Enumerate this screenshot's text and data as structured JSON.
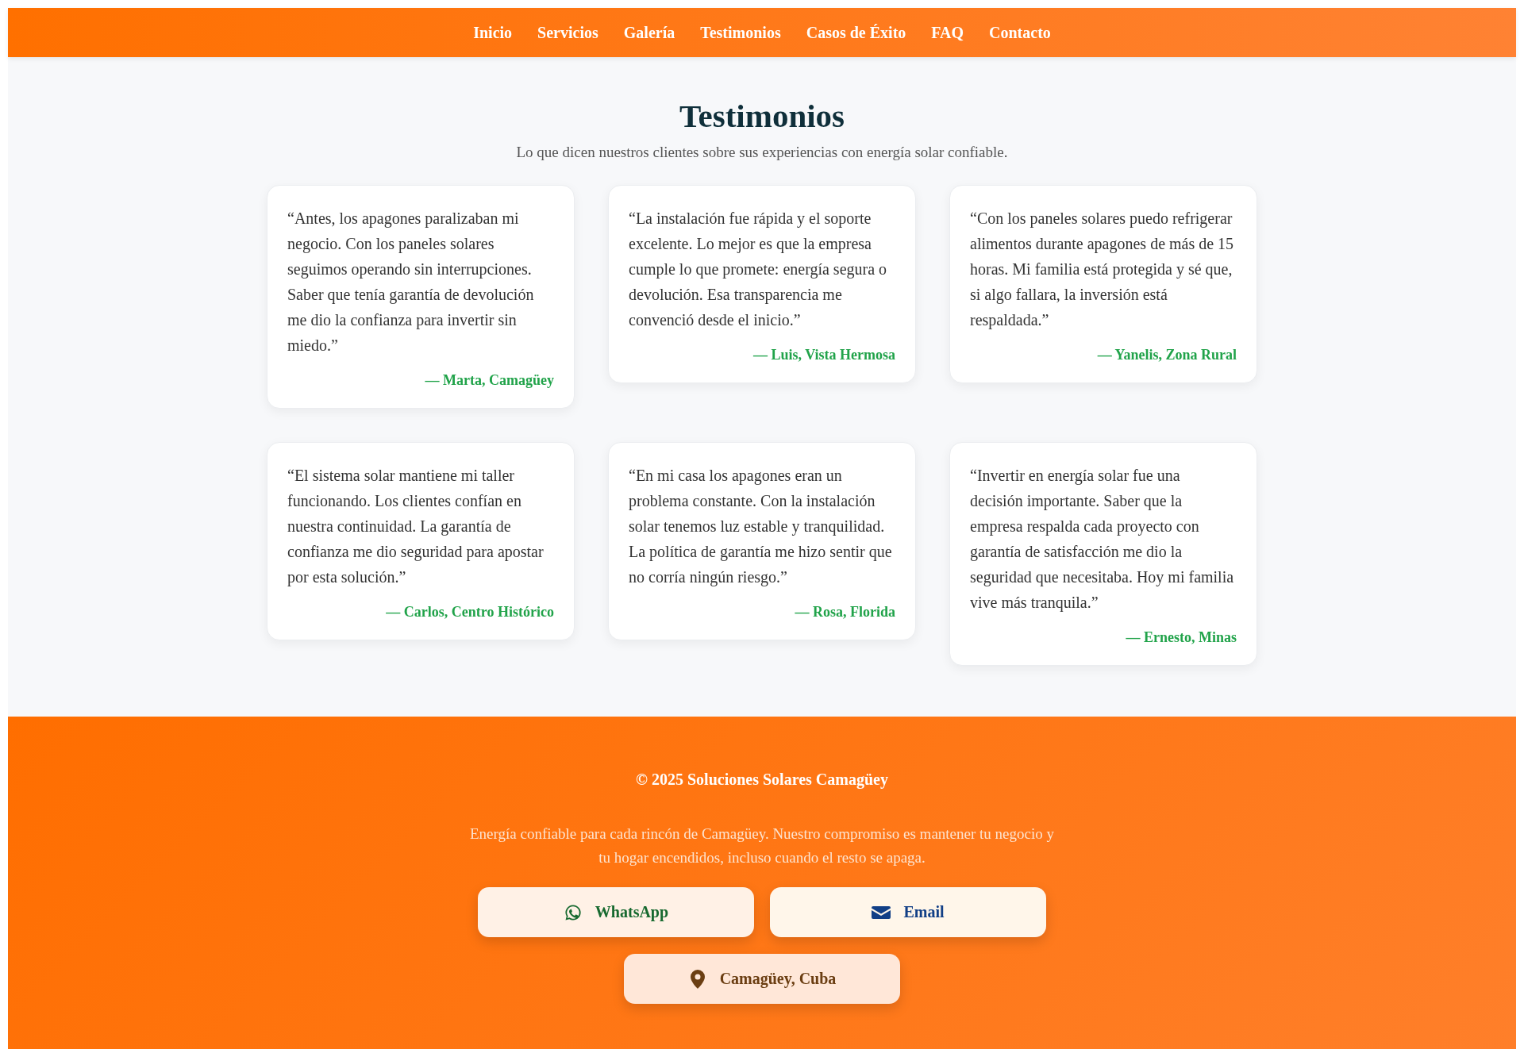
{
  "nav": [
    {
      "label": "Inicio"
    },
    {
      "label": "Servicios"
    },
    {
      "label": "Galería"
    },
    {
      "label": "Testimonios"
    },
    {
      "label": "Casos de Éxito"
    },
    {
      "label": "FAQ"
    },
    {
      "label": "Contacto"
    }
  ],
  "section": {
    "title": "Testimonios",
    "subtitle": "Lo que dicen nuestros clientes sobre sus experiencias con energía solar confiable."
  },
  "testimonials": [
    {
      "quote": "“Antes, los apagones paralizaban mi negocio. Con los paneles solares seguimos operando sin interrupciones. Saber que tenía garantía de devolución me dio la confianza para invertir sin miedo.”",
      "author": "— Marta, Camagüey"
    },
    {
      "quote": "“La instalación fue rápida y el soporte excelente. Lo mejor es que la empresa cumple lo que promete: energía segura o devolución. Esa transparencia me convenció desde el inicio.”",
      "author": "— Luis, Vista Hermosa"
    },
    {
      "quote": "“Con los paneles solares puedo refrigerar alimentos durante apagones de más de 15 horas. Mi familia está protegida y sé que, si algo fallara, la inversión está respaldada.”",
      "author": "— Yanelis, Zona Rural"
    },
    {
      "quote": "“El sistema solar mantiene mi taller funcionando. Los clientes confían en nuestra continuidad. La garantía de confianza me dio seguridad para apostar por esta solución.”",
      "author": "— Carlos, Centro Histórico"
    },
    {
      "quote": "“En mi casa los apagones eran un problema constante. Con la instalación solar tenemos luz estable y tranquilidad. La política de garantía me hizo sentir que no corría ningún riesgo.”",
      "author": "— Rosa, Florida"
    },
    {
      "quote": "“Invertir en energía solar fue una decisión importante. Saber que la empresa respalda cada proyecto con garantía de satisfacción me dio la seguridad que necesitaba. Hoy mi familia vive más tranquila.”",
      "author": "— Ernesto, Minas"
    }
  ],
  "footer": {
    "copyright": "© 2025 Soluciones Solares Camagüey",
    "text": "Energía confiable para cada rincón de Camagüey. Nuestro compromiso es mantener tu negocio y tu hogar encendidos, incluso cuando el resto se apaga.",
    "buttons": [
      {
        "kind": "whatsapp",
        "label": "WhatsApp"
      },
      {
        "kind": "email",
        "label": "Email"
      },
      {
        "kind": "location",
        "label": "Camagüey, Cuba"
      }
    ]
  }
}
